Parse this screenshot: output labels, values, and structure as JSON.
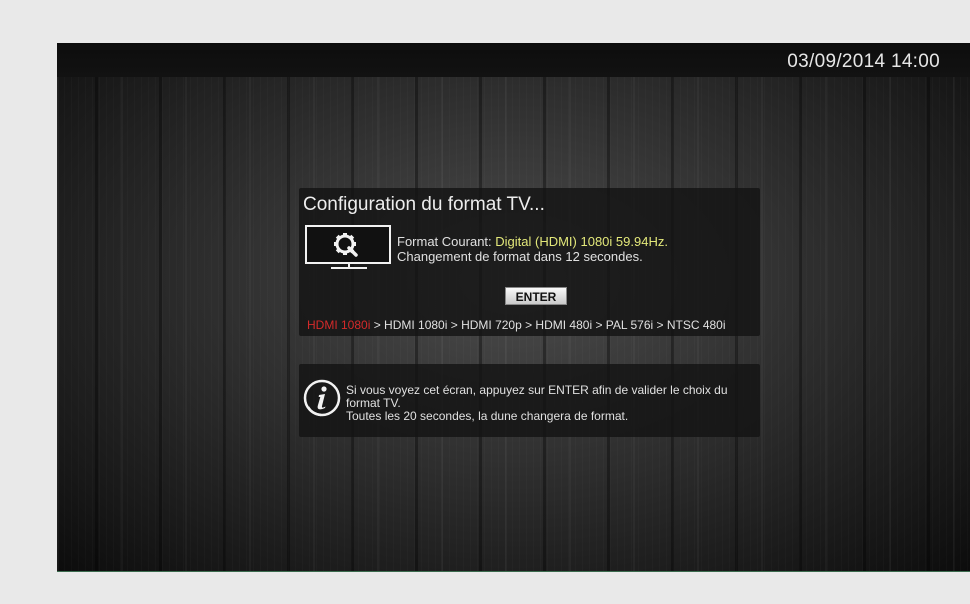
{
  "datetime": "03/09/2014 14:00",
  "config": {
    "title": "Configuration du format TV...",
    "current_format_label": "Format Courant: ",
    "current_format_value": "Digital (HDMI) 1080i 59.94Hz.",
    "change_message": "Changement de format dans 12 secondes.",
    "enter_label": "ENTER",
    "format_current": "HDMI 1080i",
    "format_sequence_rest": " > HDMI 1080i > HDMI 720p > HDMI 480i > PAL 576i > NTSC 480i",
    "icon": "tv-settings-icon"
  },
  "info": {
    "icon": "info-icon",
    "line1": "Si vous voyez cet écran, appuyez sur ENTER afin de valider le choix du format TV.",
    "line2": "Toutes les 20 secondes, la dune changera de format."
  },
  "colors": {
    "highlight_yellow": "#e3e87a",
    "current_format_red": "#d42a2a"
  }
}
